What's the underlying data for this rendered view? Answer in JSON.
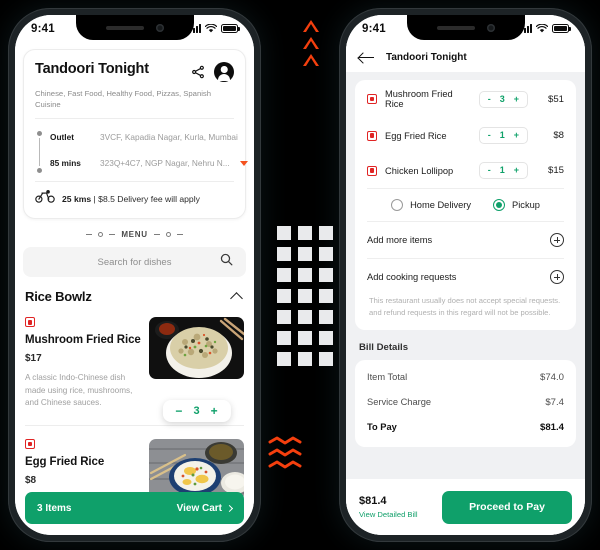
{
  "theme": {
    "accent_green": "#0fa06a",
    "accent_orange": "#f43f0e",
    "nonveg_red": "#e02424",
    "bg": "#000000"
  },
  "left_phone": {
    "status_bar": {
      "time": "9:41",
      "signal_icon": "signal-bars-icon",
      "wifi_icon": "wifi-icon",
      "battery_icon": "battery-icon"
    },
    "restaurant": {
      "name": "Tandoori Tonight",
      "share_icon": "share-icon",
      "account_icon": "account-avatar-icon",
      "cuisines": "Chinese, Fast Food, Healthy Food, Pizzas, Spanish Cuisine",
      "addresses": [
        {
          "label": "Outlet",
          "value": "3VCF, Kapadia Nagar, Kurla, Mumbai"
        },
        {
          "label": "85 mins",
          "value": "323Q+4C7, NGP Nagar, Nehru N..."
        }
      ],
      "delivery_icon": "bicycle-icon",
      "distance": "25 kms",
      "fee_text": "| $8.5 Delivery fee will apply"
    },
    "menu_divider_label": "MENU",
    "search": {
      "placeholder": "Search for dishes",
      "icon": "search-icon"
    },
    "section": {
      "title": "Rice Bowlz",
      "collapse_icon": "chevron-up-icon"
    },
    "dishes": [
      {
        "marker": "non-veg-marker-icon",
        "name": "Mushroom Fried Rice",
        "price": "$17",
        "description": "A classic Indo-Chinese dish made using rice, mushrooms, and Chinese sauces.",
        "image": "mushroom-fried-rice-photo",
        "stepper": {
          "minus": "−",
          "qty": "3",
          "plus": "+"
        }
      },
      {
        "marker": "non-veg-marker-icon",
        "name": "Egg Fried Rice",
        "price": "$8",
        "description": "",
        "image": "egg-fried-rice-photo"
      }
    ],
    "cart_bar": {
      "items_label": "3 Items",
      "view_label": "View Cart",
      "chevron_icon": "chevron-right-icon"
    }
  },
  "right_phone": {
    "status_bar": {
      "time": "9:41",
      "signal_icon": "signal-bars-icon",
      "wifi_icon": "wifi-icon",
      "battery_icon": "battery-icon"
    },
    "topbar": {
      "back_icon": "back-arrow-icon",
      "title": "Tandoori Tonight"
    },
    "cart_items": [
      {
        "marker": "non-veg-marker-icon",
        "name": "Mushroom Fried Rice",
        "minus": "-",
        "qty": "3",
        "plus": "+",
        "price": "$51"
      },
      {
        "marker": "non-veg-marker-icon",
        "name": "Egg Fried Rice",
        "minus": "-",
        "qty": "1",
        "plus": "+",
        "price": "$8"
      },
      {
        "marker": "non-veg-marker-icon",
        "name": "Chicken Lollipop",
        "minus": "-",
        "qty": "1",
        "plus": "+",
        "price": "$15"
      }
    ],
    "fulfilment": {
      "options": [
        {
          "label": "Home Delivery",
          "selected": false
        },
        {
          "label": "Pickup",
          "selected": true
        }
      ]
    },
    "add_rows": [
      {
        "label": "Add more items",
        "icon": "plus-circle-icon"
      },
      {
        "label": "Add cooking requests",
        "icon": "plus-circle-icon"
      }
    ],
    "cooking_note": "This restaurant usually does not accept special requests. and refund requests in this regard will not be possible.",
    "bill": {
      "heading": "Bill Details",
      "rows": [
        {
          "label": "Item Total",
          "value": "$74.0"
        },
        {
          "label": "Service Charge",
          "value": "$7.4"
        },
        {
          "label": "To Pay",
          "value": "$81.4"
        }
      ]
    },
    "pay_bar": {
      "amount": "$81.4",
      "detail_link": "View Detailed Bill",
      "button_label": "Proceed to Pay"
    }
  },
  "decorations": {
    "triangles": {
      "name": "triangle-outline-decor",
      "count": 3,
      "color": "#f43f0e"
    },
    "grid": {
      "name": "square-grid-decor",
      "columns": 3,
      "rows": 7,
      "color": "#e9eaec"
    },
    "waves": {
      "name": "zigzag-wave-decor",
      "count": 3,
      "color": "#f43f0e"
    }
  }
}
